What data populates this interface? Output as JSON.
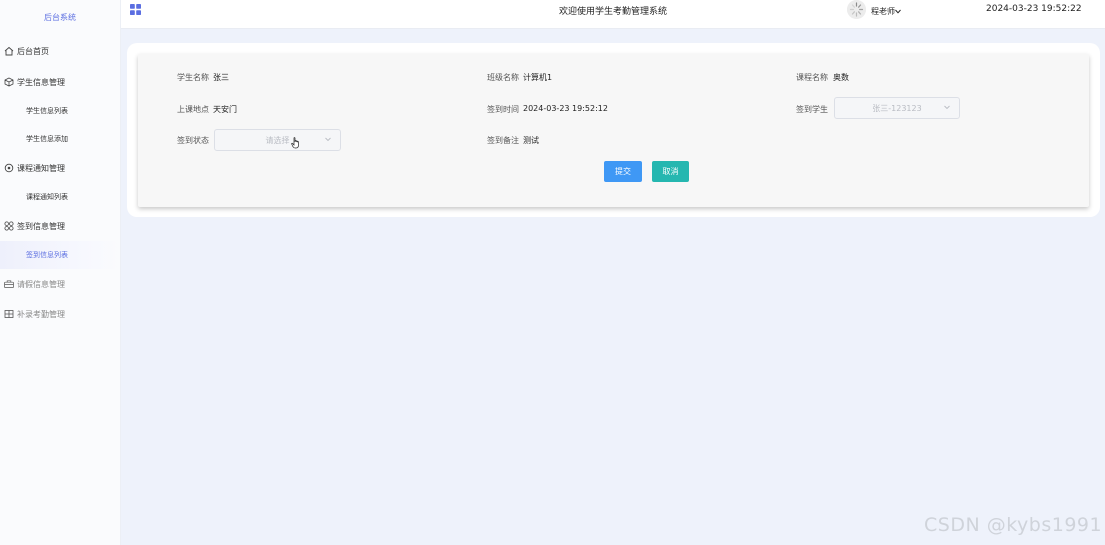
{
  "sidebar": {
    "brand": "后台系统",
    "menu": [
      {
        "label": "后台首页",
        "icon": "home-icon"
      },
      {
        "label": "学生信息管理",
        "icon": "cube-icon",
        "children": [
          "学生信息列表",
          "学生信息添加"
        ]
      },
      {
        "label": "课程通知管理",
        "icon": "target-icon",
        "children": [
          "课程通知列表"
        ]
      },
      {
        "label": "签到信息管理",
        "icon": "apps-icon",
        "children": [
          "签到信息列表"
        ],
        "active_child": "签到信息列表"
      },
      {
        "label": "请假信息管理",
        "icon": "bag-icon"
      },
      {
        "label": "补录考勤管理",
        "icon": "panel-icon"
      }
    ]
  },
  "header": {
    "title": "欢迎使用学生考勤管理系统",
    "user": "程老师",
    "datetime": "2024-03-23 19:52:22"
  },
  "form": {
    "student_name_label": "学生名称",
    "student_name": "张三",
    "class_name_label": "班级名称",
    "class_name": "计算机1",
    "course_name_label": "课程名称",
    "course_name": "奥数",
    "location_label": "上课地点",
    "location": "天安门",
    "signin_time_label": "签到时间",
    "signin_time": "2024-03-23 19:52:12",
    "signin_student_label": "签到学生",
    "signin_student_value": "张三-123123",
    "signin_status_label": "签到状态",
    "signin_status_placeholder": "请选择",
    "remark_label": "签到备注",
    "remark": "测试",
    "submit_label": "提交",
    "cancel_label": "取消"
  },
  "watermark": "CSDN @kybs1991",
  "colors": {
    "accent": "#5b6ee1",
    "primary_button": "#3f98f5",
    "cancel_button": "#25b7b0",
    "background": "#eef2fb"
  }
}
